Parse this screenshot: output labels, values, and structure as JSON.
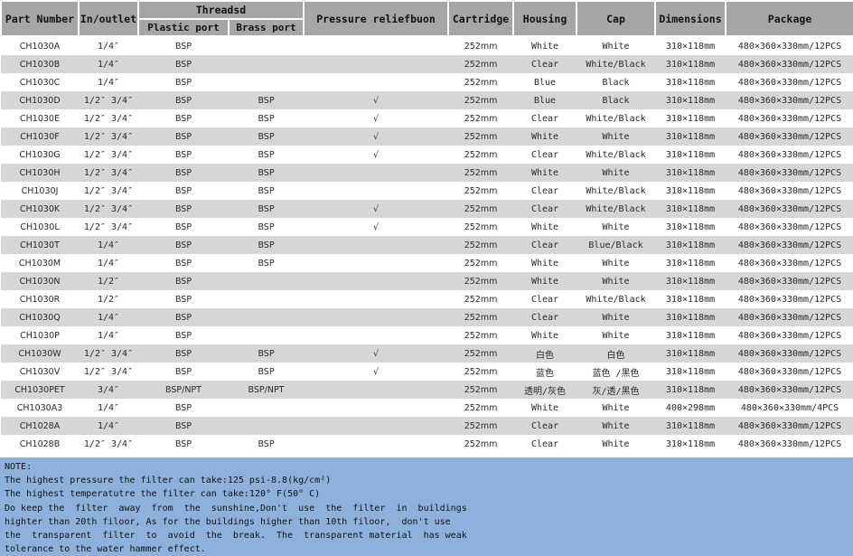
{
  "header": {
    "part_number": "Part Number",
    "in_outlet": "In/outlet",
    "threads": "Threadsd",
    "plastic_port": "Plastic port",
    "brass_port": "Brass port",
    "pressure_relief": "Pressure reliefbuon",
    "cartridge": "Cartridge",
    "housing": "Housing",
    "cap": "Cap",
    "dimensions": "Dimensions",
    "package": "Package"
  },
  "rows": [
    {
      "part": "CH1030A",
      "io": "1/4″",
      "plastic": "BSP",
      "brass": "",
      "relief": "",
      "cartridge": "252mm",
      "housing": "White",
      "cap": "White",
      "dims": "310×118mm",
      "pkg": "480×360×330mm/12PCS"
    },
    {
      "part": "CH1030B",
      "io": "1/4″",
      "plastic": "BSP",
      "brass": "",
      "relief": "",
      "cartridge": "252mm",
      "housing": "Clear",
      "cap": "White/Black",
      "dims": "310×118mm",
      "pkg": "480×360×330mm/12PCS"
    },
    {
      "part": "CH1030C",
      "io": "1/4″",
      "plastic": "BSP",
      "brass": "",
      "relief": "",
      "cartridge": "252mm",
      "housing": "Blue",
      "cap": "Black",
      "dims": "310×118mm",
      "pkg": "480×360×330mm/12PCS"
    },
    {
      "part": "CH1030D",
      "io": "1/2″  3/4″",
      "plastic": "BSP",
      "brass": "BSP",
      "relief": "√",
      "cartridge": "252mm",
      "housing": "Blue",
      "cap": "Black",
      "dims": "310×118mm",
      "pkg": "480×360×330mm/12PCS"
    },
    {
      "part": "CH1030E",
      "io": "1/2″  3/4″",
      "plastic": "BSP",
      "brass": "BSP",
      "relief": "√",
      "cartridge": "252mm",
      "housing": "Clear",
      "cap": "White/Black",
      "dims": "310×118mm",
      "pkg": "480×360×330mm/12PCS"
    },
    {
      "part": "CH1030F",
      "io": "1/2″  3/4″",
      "plastic": "BSP",
      "brass": "BSP",
      "relief": "√",
      "cartridge": "252mm",
      "housing": "White",
      "cap": "White",
      "dims": "310×118mm",
      "pkg": "480×360×330mm/12PCS"
    },
    {
      "part": "CH1030G",
      "io": "1/2″  3/4″",
      "plastic": "BSP",
      "brass": "BSP",
      "relief": "√",
      "cartridge": "252mm",
      "housing": "Clear",
      "cap": "White/Black",
      "dims": "310×118mm",
      "pkg": "480×360×330mm/12PCS"
    },
    {
      "part": "CH1030H",
      "io": "1/2″  3/4″",
      "plastic": "BSP",
      "brass": "BSP",
      "relief": "",
      "cartridge": "252mm",
      "housing": "White",
      "cap": "White",
      "dims": "310×118mm",
      "pkg": "480×360×330mm/12PCS"
    },
    {
      "part": "CH1030J",
      "io": "1/2″  3/4″",
      "plastic": "BSP",
      "brass": "BSP",
      "relief": "",
      "cartridge": "252mm",
      "housing": "Clear",
      "cap": "White/Black",
      "dims": "310×118mm",
      "pkg": "480×360×330mm/12PCS"
    },
    {
      "part": "CH1030K",
      "io": "1/2″  3/4″",
      "plastic": "BSP",
      "brass": "BSP",
      "relief": "√",
      "cartridge": "252mm",
      "housing": "Clear",
      "cap": "White/Black",
      "dims": "310×118mm",
      "pkg": "480×360×330mm/12PCS"
    },
    {
      "part": "CH1030L",
      "io": "1/2″  3/4″",
      "plastic": "BSP",
      "brass": "BSP",
      "relief": "√",
      "cartridge": "252mm",
      "housing": "White",
      "cap": "White",
      "dims": "310×118mm",
      "pkg": "480×360×330mm/12PCS"
    },
    {
      "part": "CH1030T",
      "io": "1/4″",
      "plastic": "BSP",
      "brass": "BSP",
      "relief": "",
      "cartridge": "252mm",
      "housing": "Clear",
      "cap": "Blue/Black",
      "dims": "310×118mm",
      "pkg": "480×360×330mm/12PCS"
    },
    {
      "part": "CH1030M",
      "io": "1/4″",
      "plastic": "BSP",
      "brass": "BSP",
      "relief": "",
      "cartridge": "252mm",
      "housing": "White",
      "cap": "White",
      "dims": "310×118mm",
      "pkg": "480×360×330mm/12PCS"
    },
    {
      "part": "CH1030N",
      "io": "1/2″",
      "plastic": "BSP",
      "brass": "",
      "relief": "",
      "cartridge": "252mm",
      "housing": "White",
      "cap": "White",
      "dims": "310×118mm",
      "pkg": "480×360×330mm/12PCS"
    },
    {
      "part": "CH1030R",
      "io": "1/2″",
      "plastic": "BSP",
      "brass": "",
      "relief": "",
      "cartridge": "252mm",
      "housing": "Clear",
      "cap": "White/Black",
      "dims": "310×118mm",
      "pkg": "480×360×330mm/12PCS"
    },
    {
      "part": "CH1030Q",
      "io": "1/4″",
      "plastic": "BSP",
      "brass": "",
      "relief": "",
      "cartridge": "252mm",
      "housing": "Clear",
      "cap": "White",
      "dims": "310×118mm",
      "pkg": "480×360×330mm/12PCS"
    },
    {
      "part": "CH1030P",
      "io": "1/4″",
      "plastic": "BSP",
      "brass": "",
      "relief": "",
      "cartridge": "252mm",
      "housing": "White",
      "cap": "White",
      "dims": "310×118mm",
      "pkg": "480×360×330mm/12PCS"
    },
    {
      "part": "CH1030W",
      "io": "1/2″  3/4″",
      "plastic": "BSP",
      "brass": "BSP",
      "relief": "√",
      "cartridge": "252mm",
      "housing": "白色",
      "cap": "白色",
      "dims": "310×118mm",
      "pkg": "480×360×330mm/12PCS"
    },
    {
      "part": "CH1030V",
      "io": "1/2″  3/4″",
      "plastic": "BSP",
      "brass": "BSP",
      "relief": "√",
      "cartridge": "252mm",
      "housing": "蓝色",
      "cap": "蓝色 /黑色",
      "dims": "310×118mm",
      "pkg": "480×360×330mm/12PCS"
    },
    {
      "part": "CH1030PET",
      "io": "3/4″",
      "plastic": "BSP/NPT",
      "brass": "BSP/NPT",
      "relief": "",
      "cartridge": "252mm",
      "housing": "透明/灰色",
      "cap": "灰/透/黑色",
      "dims": "310×118mm",
      "pkg": "480×360×330mm/12PCS"
    },
    {
      "part": "CH1030A3",
      "io": "1/4″",
      "plastic": "BSP",
      "brass": "",
      "relief": "",
      "cartridge": "252mm",
      "housing": "White",
      "cap": "White",
      "dims": "400×298mm",
      "pkg": "480×360×330mm/4PCS"
    },
    {
      "part": "CH1028A",
      "io": "1/4″",
      "plastic": "BSP",
      "brass": "",
      "relief": "",
      "cartridge": "252mm",
      "housing": "Clear",
      "cap": "White",
      "dims": "310×118mm",
      "pkg": "480×360×330mm/12PCS"
    },
    {
      "part": "CH1028B",
      "io": "1/2″  3/4″",
      "plastic": "BSP",
      "brass": "BSP",
      "relief": "",
      "cartridge": "252mm",
      "housing": "Clear",
      "cap": "White",
      "dims": "310×118mm",
      "pkg": "480×360×330mm/12PCS"
    }
  ],
  "notes": [
    "NOTE:",
    "The highest pressure the filter can take:125 psi-8.8(kg/cm²)",
    "The highest temperatutre the filter can take:120° F(50° C)",
    "Do keep the  filter  away  from  the  sunshine,Don't  use  the  filter  in  buildings",
    "highter than 20th filoor, As for the buildings higher than 10th filoor,  don't use",
    "the  transparent  filter  to  avoid  the  break.  The  transparent material  has weak",
    "tolerance to the water hammer effect."
  ],
  "colors": {
    "header_bg": "#a6a6a6",
    "row_alt_bg": "#d6d6d6",
    "notes_bg": "#8eb1dc"
  }
}
